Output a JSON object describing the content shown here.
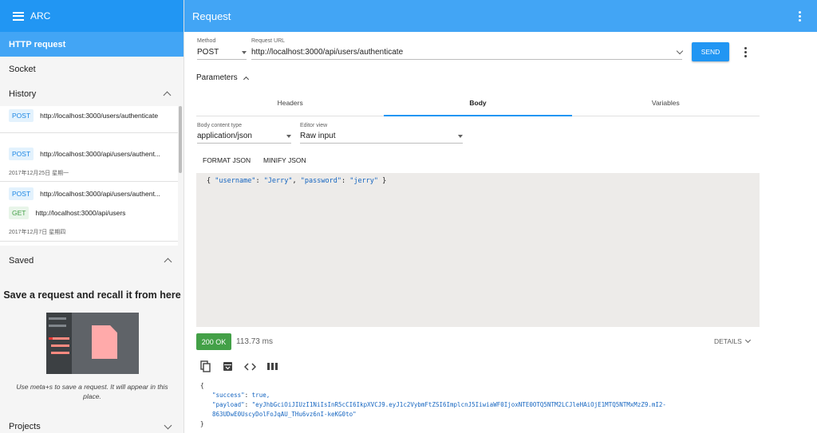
{
  "sidebar": {
    "app_title": "ARC",
    "active_item": "HTTP request",
    "socket_item": "Socket",
    "history": {
      "label": "History",
      "entries": [
        {
          "method": "POST",
          "url": "http://localhost:3000/users/authenticate"
        },
        {
          "method": "POST",
          "url": "http://localhost:3000/api/users/authent..."
        },
        {
          "method": "POST",
          "url": "http://localhost:3000/api/users/authent..."
        },
        {
          "method": "GET",
          "url": "http://localhost:3000/api/users"
        }
      ],
      "dates": [
        "2017年12月25日 星期一",
        "2017年12月7日 星期四"
      ]
    },
    "saved": {
      "label": "Saved",
      "empty_title": "Save a request and recall it from here",
      "empty_text": "Use meta+s to save a request. It will appear in this place."
    },
    "projects_label": "Projects"
  },
  "main": {
    "title": "Request",
    "method": {
      "label": "Method",
      "value": "POST"
    },
    "url": {
      "label": "Request URL",
      "value": "http://localhost:3000/api/users/authenticate"
    },
    "send_label": "SEND",
    "parameters_label": "Parameters",
    "tabs": [
      {
        "label": "Headers"
      },
      {
        "label": "Body"
      },
      {
        "label": "Variables"
      }
    ],
    "body_content_type": {
      "label": "Body content type",
      "value": "application/json"
    },
    "editor_view": {
      "label": "Editor view",
      "value": "Raw input"
    },
    "format_json_label": "FORMAT JSON",
    "minify_json_label": "MINIFY JSON",
    "request_body": {
      "open": "{ ",
      "k1": "\"username\"",
      "colon1": ": ",
      "v1": "\"Jerry\"",
      "comma": ", ",
      "k2": "\"password\"",
      "colon2": ": ",
      "v2": "\"jerry\"",
      "close": " }"
    },
    "response": {
      "status": "200 OK",
      "time": "113.73 ms",
      "details_label": "DETAILS",
      "icons": [
        "copy-icon",
        "archive-icon",
        "code-icon",
        "columns-icon"
      ],
      "body": {
        "open": "{",
        "success_key": "\"success\"",
        "success_val": "true,",
        "payload_key": "\"payload\"",
        "payload_line1": "\"eyJhbGciOiJIUzI1NiIsInR5cCI6IkpXVCJ9.eyJ1c2VybmFtZSI6ImplcnJ5IiwiaWF0IjoxNTE0OTQ5NTM2LCJleHAiOjE1MTQ5NTMxMzZ9.mI2-",
        "payload_line2": "863UDwE0UscyDolFoJqAU_THu6vz6nI-keKG0to\"",
        "close": "}"
      }
    }
  },
  "colors": {
    "app_bar": "#42a5f5",
    "primary": "#2196f3",
    "status_ok": "#43a047",
    "editor_bg": "#edebe9"
  }
}
